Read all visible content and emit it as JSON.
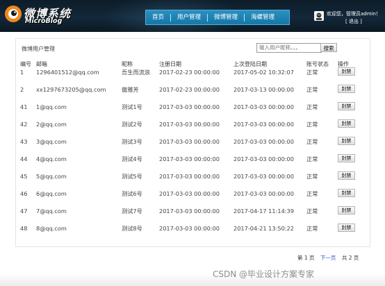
{
  "brand": {
    "name_cn": "微博系统",
    "name_en": "MicroBlog"
  },
  "nav": {
    "items": [
      "首页",
      "用户管理",
      "微博管理",
      "海螺管理"
    ]
  },
  "user": {
    "welcome": "欢迎您，管理员admin！",
    "logout": "[ 退出 ]"
  },
  "panel": {
    "title": "微博用户管理",
    "search_placeholder": "输入用户昵称。。。",
    "search_button": "搜索"
  },
  "table": {
    "headers": [
      "编号",
      "邮箱",
      "昵称",
      "注册日期",
      "上次登陆日期",
      "账号状态",
      "操作"
    ],
    "rows": [
      {
        "id": "1",
        "email": "1296401512@qq.com",
        "nick": "吾生而流浪",
        "reg": "2017-02-23 00:00:00",
        "last": "2017-05-02 10:32:07",
        "status": "正常",
        "action": "封禁"
      },
      {
        "id": "2",
        "email": "xx1297673205@qq.com",
        "nick": "傲雅芳",
        "reg": "2017-02-23 00:00:00",
        "last": "2017-03-13 00:00:00",
        "status": "正常",
        "action": "封禁"
      },
      {
        "id": "41",
        "email": "1@qq.com",
        "nick": "测试1号",
        "reg": "2017-03-03 00:00:00",
        "last": "2017-03-03 00:00:00",
        "status": "正常",
        "action": "封禁"
      },
      {
        "id": "42",
        "email": "2@qq.com",
        "nick": "测试2号",
        "reg": "2017-03-03 00:00:00",
        "last": "2017-03-03 00:00:00",
        "status": "正常",
        "action": "封禁"
      },
      {
        "id": "43",
        "email": "3@qq.com",
        "nick": "测试3号",
        "reg": "2017-03-03 00:00:00",
        "last": "2017-03-03 00:00:00",
        "status": "正常",
        "action": "封禁"
      },
      {
        "id": "44",
        "email": "4@qq.com",
        "nick": "测试4号",
        "reg": "2017-03-03 00:00:00",
        "last": "2017-03-03 00:00:00",
        "status": "正常",
        "action": "封禁"
      },
      {
        "id": "45",
        "email": "5@qq.com",
        "nick": "测试5号",
        "reg": "2017-03-03 00:00:00",
        "last": "2017-03-03 00:00:00",
        "status": "正常",
        "action": "封禁"
      },
      {
        "id": "46",
        "email": "6@qq.com",
        "nick": "测试6号",
        "reg": "2017-03-03 00:00:00",
        "last": "2017-03-03 00:00:00",
        "status": "正常",
        "action": "封禁"
      },
      {
        "id": "47",
        "email": "7@qq.com",
        "nick": "测试7号",
        "reg": "2017-03-03 00:00:00",
        "last": "2017-04-17 11:14:39",
        "status": "正常",
        "action": "封禁"
      },
      {
        "id": "48",
        "email": "8@qq.com",
        "nick": "测试8号",
        "reg": "2017-03-03 00:00:00",
        "last": "2017-04-21 13:50:22",
        "status": "正常",
        "action": "封禁"
      }
    ]
  },
  "pager": {
    "current": "第 1 页",
    "next": "下一页",
    "total": "共  2  页"
  },
  "watermark": "CSDN @毕业设计方案专家",
  "colors": {
    "header_bg": "#13283a",
    "nav_bg": "#1a82b4",
    "link": "#2c5ab8"
  },
  "icons": {
    "logo": "eye-logo-icon",
    "avatar": "user-avatar-icon"
  }
}
